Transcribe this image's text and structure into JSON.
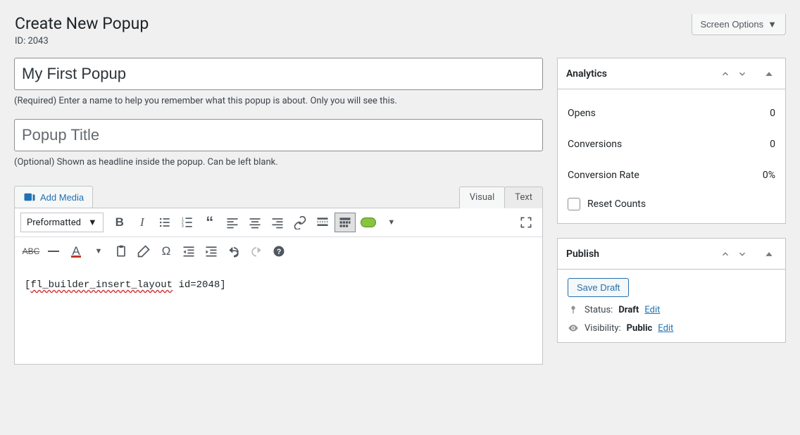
{
  "screen_options": "Screen Options",
  "page_title": "Create New Popup",
  "popup_id_label": "ID: 2043",
  "name_input_value": "My First Popup",
  "name_helper": "(Required) Enter a name to help you remember what this popup is about. Only you will see this.",
  "title_input_placeholder": "Popup Title",
  "title_helper": "(Optional) Shown as headline inside the popup. Can be left blank.",
  "add_media_label": "Add Media",
  "tabs": {
    "visual": "Visual",
    "text": "Text"
  },
  "format_select_label": "Preformatted",
  "editor_content": {
    "open_bracket": "[",
    "shortcode_name": "fl_builder_insert_layout",
    "rest": " id=2048]"
  },
  "analytics": {
    "title": "Analytics",
    "rows": [
      {
        "label": "Opens",
        "value": "0"
      },
      {
        "label": "Conversions",
        "value": "0"
      },
      {
        "label": "Conversion Rate",
        "value": "0%"
      }
    ],
    "reset_label": "Reset Counts"
  },
  "publish": {
    "title": "Publish",
    "save_draft": "Save Draft",
    "status_label": "Status:",
    "status_value": "Draft",
    "visibility_label": "Visibility:",
    "visibility_value": "Public",
    "edit": "Edit"
  }
}
